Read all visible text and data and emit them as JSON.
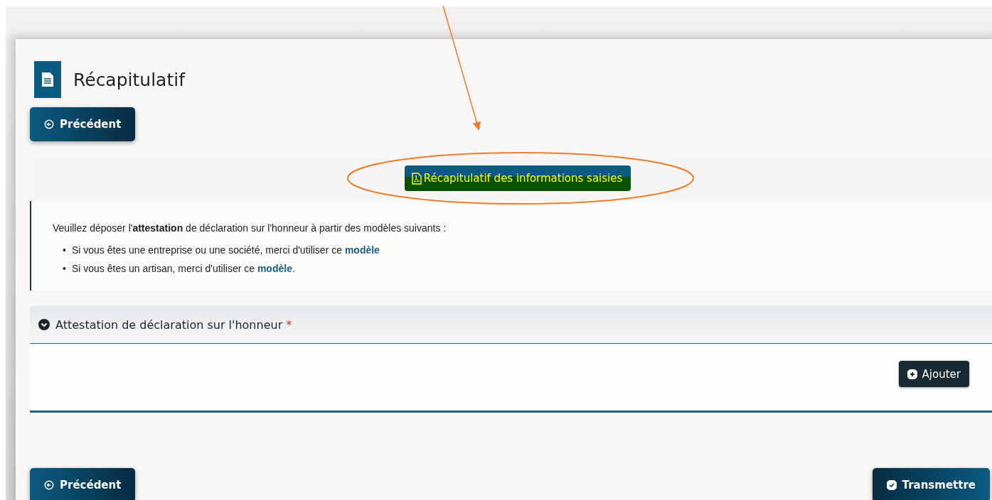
{
  "page": {
    "title": "Récapitulatif"
  },
  "nav_top": {
    "previous_button": "Précédent"
  },
  "summary_button": {
    "label": "Récapitulatif des informations saisies",
    "highlighted": true
  },
  "notice": {
    "intro": "Veuillez déposer l'**attestation** de déclaration sur l'honneur à partir des modèles suivants :",
    "items": [
      {
        "marker": "•",
        "text": "Si vous êtes une entreprise ou une société, merci d'utiliser ce",
        "link": "modèle"
      },
      {
        "marker": "•",
        "text": "Si vous êtes un artisan, merci d'utiliser ce",
        "link": "modèle",
        "suffix": "."
      }
    ]
  },
  "section": {
    "title": "Attestation de déclaration sur l'honneur",
    "required_mark": "*",
    "expanded": true,
    "add_button": "Ajouter"
  },
  "footer": {
    "previous_button": "Précédent",
    "submit_button": "Transmettre"
  },
  "annotations": {
    "arrow": true,
    "ellipse": true
  }
}
